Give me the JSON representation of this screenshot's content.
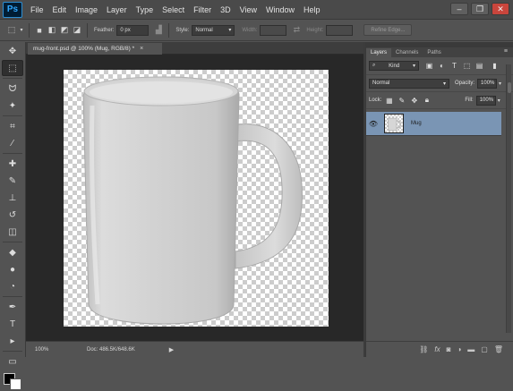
{
  "app": {
    "logo": "Ps",
    "menu": [
      "File",
      "Edit",
      "Image",
      "Layer",
      "Type",
      "Select",
      "Filter",
      "3D",
      "View",
      "Window",
      "Help"
    ],
    "window_controls": {
      "minimize": "–",
      "restore": "❐",
      "close": "✕"
    }
  },
  "options_bar": {
    "feather_label": "Feather:",
    "feather_value": "0 px",
    "style_label": "Style:",
    "style_value": "Normal",
    "width_label": "Width:",
    "height_label": "Height:",
    "refine_edge": "Refine Edge..."
  },
  "document": {
    "tab_title": "mug-front.psd @ 100% (Mug, RGB/8) *",
    "tab_close": "×",
    "zoom": "100%",
    "doc_info": "Doc: 486.5K/648.6K"
  },
  "tools": [
    {
      "icon": "move-tool-icon",
      "glyph": "✥"
    },
    {
      "icon": "marquee-tool-icon",
      "glyph": "⬚",
      "active": true
    },
    {
      "icon": "lasso-tool-icon",
      "glyph": "ᗢ"
    },
    {
      "icon": "magic-wand-tool-icon",
      "glyph": "✦"
    },
    {
      "icon": "crop-tool-icon",
      "glyph": "⌗"
    },
    {
      "icon": "eyedropper-tool-icon",
      "glyph": "⁄"
    },
    {
      "icon": "healing-brush-tool-icon",
      "glyph": "✚"
    },
    {
      "icon": "brush-tool-icon",
      "glyph": "✎"
    },
    {
      "icon": "clone-stamp-tool-icon",
      "glyph": "⊥"
    },
    {
      "icon": "history-brush-tool-icon",
      "glyph": "↺"
    },
    {
      "icon": "eraser-tool-icon",
      "glyph": "◫"
    },
    {
      "icon": "paint-bucket-tool-icon",
      "glyph": "◆"
    },
    {
      "icon": "blur-tool-icon",
      "glyph": "●"
    },
    {
      "icon": "dodge-tool-icon",
      "glyph": "◔"
    },
    {
      "icon": "pen-tool-icon",
      "glyph": "✒"
    },
    {
      "icon": "type-tool-icon",
      "glyph": "T"
    },
    {
      "icon": "path-selection-tool-icon",
      "glyph": "▸"
    },
    {
      "icon": "rectangle-tool-icon",
      "glyph": "▭"
    }
  ],
  "layers_panel": {
    "tabs": [
      "Layers",
      "Channels",
      "Paths"
    ],
    "filter_kind": "Kind",
    "blend_mode": "Normal",
    "opacity_label": "Opacity:",
    "opacity_value": "100%",
    "lock_label": "Lock:",
    "fill_label": "Fill:",
    "fill_value": "100%",
    "layers": [
      {
        "name": "Mug",
        "visible": true,
        "selected": true
      }
    ]
  },
  "colors": {
    "selected_layer": "#7a95b4",
    "ps_blue": "#31a8ff"
  }
}
